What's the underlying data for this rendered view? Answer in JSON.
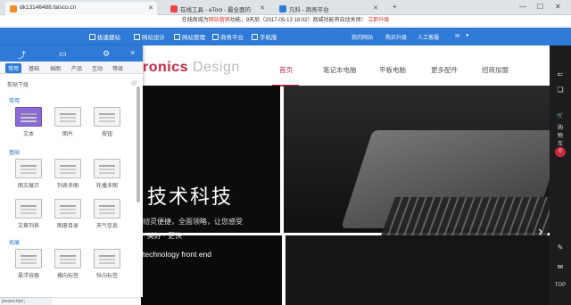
{
  "browser": {
    "tabs": [
      {
        "title": "dk13146488.faisco.cn",
        "active": true
      },
      {
        "title": "在线工具 - aTool - 最全面的",
        "active": false
      },
      {
        "title": "凡科 - 商务平台",
        "active": false
      }
    ],
    "new_tab": "+",
    "window_controls": [
      "—",
      "☐",
      "✕"
    ]
  },
  "notice": {
    "text": "在线商城为",
    "link_word": "网站营销",
    "middle": "功能，9天后（2017-05-13 18:02）商城功能将自动关闭！",
    "cta": "立即升级"
  },
  "topnav": {
    "items": [
      "极速建站",
      "网站设计",
      "网站管理",
      "商务平台",
      "手机版"
    ],
    "right": [
      "我的网站",
      "购买升级",
      "人工客服"
    ]
  },
  "site": {
    "logo_part": "ronics",
    "logo_grey": "Design",
    "menu": [
      "首页",
      "笔记本电脑",
      "平板电脑",
      "更多配件",
      "招商加盟"
    ],
    "hero_title": "技术科技",
    "hero_sub": "纫灵便捷，全面领略，让您感受",
    "hero_sub2": "· 美好 · 更快",
    "hero_en": "technology front end",
    "slide_next": "›"
  },
  "rail": {
    "items": [
      "购",
      "物",
      "车"
    ],
    "cart_count": "0",
    "top_label": "TOP"
  },
  "panel": {
    "categories": [
      "常用",
      "基础",
      "插图",
      "产品",
      "互动",
      "等级"
    ],
    "sub_filter": "剪贴下级",
    "pin": "◎",
    "sections": {
      "common": "常用",
      "basic": "基础",
      "expand": "拓展"
    },
    "common_mods": [
      "文本",
      "图片",
      "按钮"
    ],
    "basic_mods": [
      "图文展示",
      "列表多图",
      "轮播多图",
      "文章列表",
      "图册目录",
      "天气信息"
    ],
    "expand_mods": [
      "悬浮容器",
      "横向标签",
      "纵向标签"
    ],
    "close": "×"
  },
  "status": "javascript:;"
}
